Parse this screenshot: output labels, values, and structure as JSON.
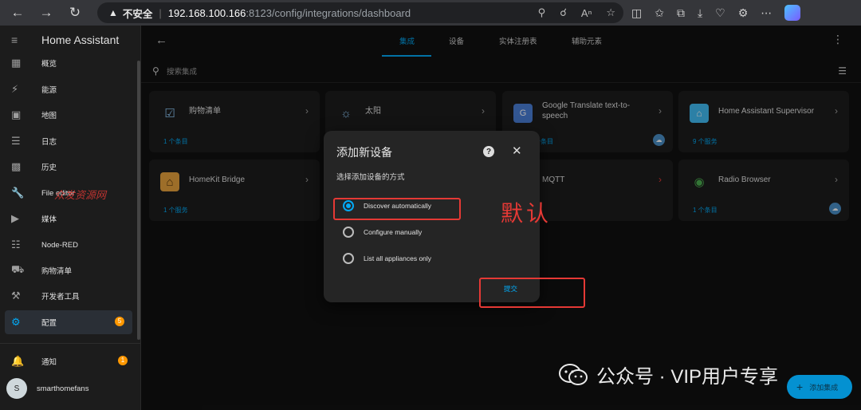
{
  "browser": {
    "insecure_label": "不安全",
    "url_host": "192.168.100.166",
    "url_path": ":8123/config/integrations/dashboard"
  },
  "sidebar": {
    "title": "Home Assistant",
    "items": [
      {
        "label": "概览",
        "icon": "dashboard-icon"
      },
      {
        "label": "能源",
        "icon": "lightning-icon"
      },
      {
        "label": "地图",
        "icon": "map-icon"
      },
      {
        "label": "日志",
        "icon": "list-icon"
      },
      {
        "label": "历史",
        "icon": "chart-icon"
      },
      {
        "label": "File editor",
        "icon": "wrench-icon"
      },
      {
        "label": "媒体",
        "icon": "media-icon"
      },
      {
        "label": "Node-RED",
        "icon": "sitemap-icon"
      },
      {
        "label": "购物清单",
        "icon": "cart-icon"
      },
      {
        "label": "开发者工具",
        "icon": "hammer-icon"
      },
      {
        "label": "配置",
        "icon": "gear-icon",
        "badge": "5"
      }
    ],
    "notifications_label": "通知",
    "notifications_badge": "1",
    "user_name": "smarthomefans",
    "user_initial": "S",
    "watermark": "众发资源网"
  },
  "tabs": [
    "集成",
    "设备",
    "实体注册表",
    "辅助元素"
  ],
  "search_placeholder": "搜索集成",
  "cards": [
    {
      "title": "购物清单",
      "subtitle": "1 个条目",
      "icon": "checklist-icon"
    },
    {
      "title": "太阳",
      "subtitle": "",
      "icon": "sun-icon"
    },
    {
      "title": "Google Translate text-to-speech",
      "subtitle": "个条目",
      "icon": "google-translate-icon",
      "cloud": true
    },
    {
      "title": "Home Assistant Supervisor",
      "subtitle": "9 个服务",
      "icon": "home-assistant-icon"
    },
    {
      "title": "HomeKit Bridge",
      "subtitle": "1 个服务",
      "icon": "homekit-icon"
    },
    {
      "title": "MQTT",
      "subtitle": "",
      "icon": "mqtt-icon"
    },
    {
      "title": "Radio Browser",
      "subtitle": "1 个条目",
      "icon": "radio-icon",
      "cloud": true
    }
  ],
  "dialog": {
    "title": "添加新设备",
    "subtitle": "选择添加设备的方式",
    "options": [
      "Discover automatically",
      "Configure manually",
      "List all appliances only"
    ],
    "selected": 0,
    "submit_label": "提交"
  },
  "annotation_default": "默认",
  "wechat_watermark": "公众号 · VIP用户专享",
  "fab_label": "添加集成"
}
